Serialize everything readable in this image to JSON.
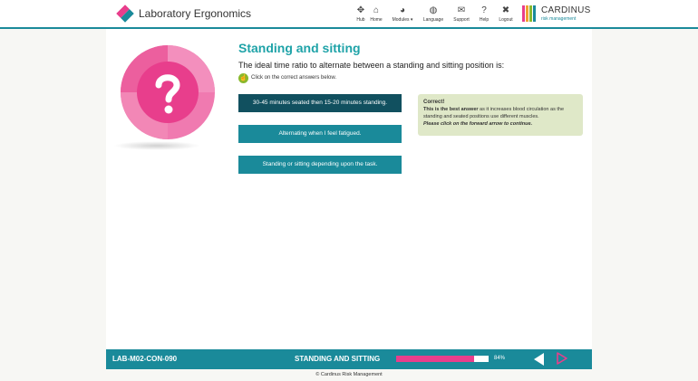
{
  "header": {
    "app_title": "Laboratory Ergonomics",
    "nav": [
      {
        "label": "Hub",
        "icon": "hub-icon"
      },
      {
        "label": "Home",
        "icon": "home-icon"
      },
      {
        "label": "Modules ▾",
        "icon": "modules-icon"
      },
      {
        "label": "Language",
        "icon": "globe-icon"
      },
      {
        "label": "Support",
        "icon": "chat-icon"
      },
      {
        "label": "Help",
        "icon": "help-icon"
      },
      {
        "label": "Logout",
        "icon": "close-icon"
      }
    ],
    "brand_name": "CARDINUS",
    "brand_sub": "risk management"
  },
  "question": {
    "title": "Standing and sitting",
    "text": "The ideal time ratio to alternate between a standing and sitting position is:",
    "instruction": "Click on the correct answers below.",
    "answers": [
      {
        "label": "30-45 minutes seated then 15-20 minutes standing.",
        "selected": true
      },
      {
        "label": "Alternating when I feel fatigued.",
        "selected": false
      },
      {
        "label": "Standing or sitting depending upon the task.",
        "selected": false
      }
    ]
  },
  "feedback": {
    "title": "Correct!",
    "line1_bold": "This is the best answer",
    "line1_rest": " as it increases blood circulation as the",
    "line2": "standing and seated positions use different muscles.",
    "line3": "Please click on the forward arrow to continue."
  },
  "footer": {
    "code": "LAB-M02-CON-090",
    "section": "STANDING AND SITTING",
    "progress": 84,
    "progress_label": "84%",
    "copyright": "© Cardinus Risk Management"
  },
  "colors": {
    "teal": "#1a8a9a",
    "dark_teal": "#11505f",
    "pink": "#e83e8c",
    "title_teal": "#1fa3a8",
    "feedback_bg": "#dfe8c8"
  }
}
